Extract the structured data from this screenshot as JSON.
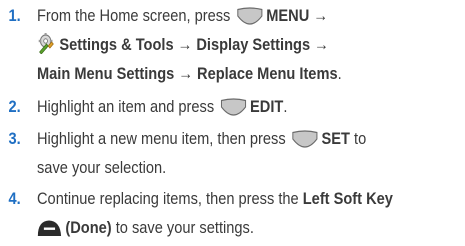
{
  "steps": [
    {
      "number": "1.",
      "line1_pre": "From the Home screen, press ",
      "line1_key_label": "MENU",
      "line1_arrow": " →",
      "line2_settings": "Settings & Tools",
      "line2_rest": " → Display Settings →",
      "line3": "Main Menu Settings → Replace Menu Items",
      "line3_end": "."
    },
    {
      "number": "2.",
      "pre": "Highlight an item and press ",
      "key_label": "EDIT",
      "end": "."
    },
    {
      "number": "3.",
      "pre": "Highlight a new menu item, then press ",
      "key_label": "SET",
      "post": " to",
      "line2": "save your selection."
    },
    {
      "number": "4.",
      "pre": "Continue replacing items, then press the ",
      "bold_label": "Left Soft Key",
      "done_label": "(Done)",
      "post": " to save your settings."
    }
  ],
  "icons": {
    "center_key": "center-select-key-icon",
    "settings": "settings-tools-icon",
    "soft_key": "left-soft-key-icon"
  },
  "colors": {
    "number": "#1f6fc3",
    "text": "#3a3a3a",
    "key_fill": "#c7c7c7",
    "key_stroke": "#6b6b6b",
    "soft_key_fill": "#2b2b2b"
  }
}
